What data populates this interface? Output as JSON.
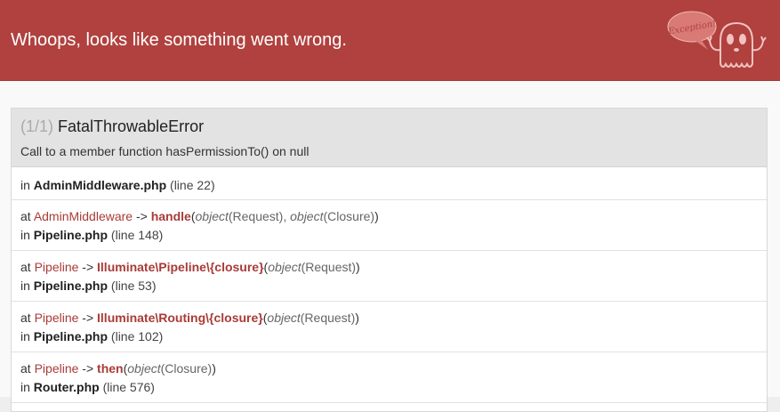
{
  "header": {
    "title": "Whoops, looks like something went wrong.",
    "logo_text": "Exception!",
    "bg_color": "#b0413e"
  },
  "exception": {
    "count": "(1/1)",
    "class": "FatalThrowableError",
    "message": "Call to a member function hasPermissionTo() on null"
  },
  "trace": [
    {
      "in_label": "in",
      "file": "AdminMiddleware.php",
      "line": "(line 22)"
    },
    {
      "at_label": "at",
      "class": "AdminMiddleware",
      "arrow": "->",
      "method": "handle",
      "open_paren": "(",
      "args": [
        {
          "type": "object",
          "value": "(Request)",
          "sep": ", "
        },
        {
          "type": "object",
          "value": "(Closure)",
          "sep": ""
        }
      ],
      "close_paren": ")",
      "in_label": "in",
      "file": "Pipeline.php",
      "line": "(line 148)"
    },
    {
      "at_label": "at",
      "class": "Pipeline",
      "arrow": "->",
      "method": "Illuminate\\Pipeline\\{closure}",
      "open_paren": "(",
      "args": [
        {
          "type": "object",
          "value": "(Request)",
          "sep": ""
        }
      ],
      "close_paren": ")",
      "in_label": "in",
      "file": "Pipeline.php",
      "line": "(line 53)"
    },
    {
      "at_label": "at",
      "class": "Pipeline",
      "arrow": "->",
      "method": "Illuminate\\Routing\\{closure}",
      "open_paren": "(",
      "args": [
        {
          "type": "object",
          "value": "(Request)",
          "sep": ""
        }
      ],
      "close_paren": ")",
      "in_label": "in",
      "file": "Pipeline.php",
      "line": "(line 102)"
    },
    {
      "at_label": "at",
      "class": "Pipeline",
      "arrow": "->",
      "method": "then",
      "open_paren": "(",
      "args": [
        {
          "type": "object",
          "value": "(Closure)",
          "sep": ""
        }
      ],
      "close_paren": ")",
      "in_label": "in",
      "file": "Router.php",
      "line": "(line 576)"
    }
  ]
}
